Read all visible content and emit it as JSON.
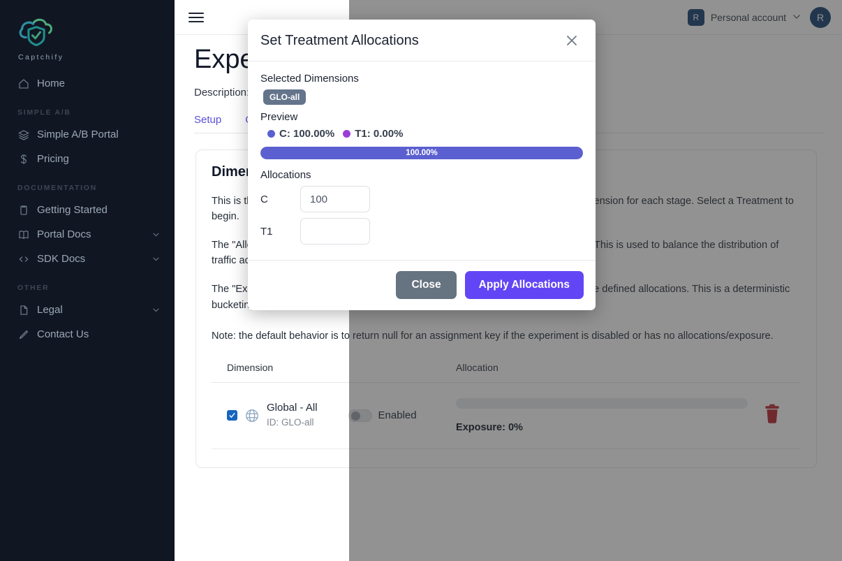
{
  "sidebar": {
    "brand_name": "Captchify",
    "items": [
      {
        "label": "Home",
        "icon": "home-icon",
        "section": null,
        "chevron": false
      },
      {
        "label": "Simple A/B Portal",
        "icon": "layers-icon",
        "section": null,
        "chevron": false
      },
      {
        "label": "Pricing",
        "icon": "dollar-icon",
        "section": null,
        "chevron": false
      },
      {
        "label": "Getting Started",
        "icon": "clipboard-icon",
        "section": null,
        "chevron": false
      },
      {
        "label": "Portal Docs",
        "icon": "book-icon",
        "section": null,
        "chevron": true
      },
      {
        "label": "SDK Docs",
        "icon": "code-icon",
        "section": null,
        "chevron": true
      },
      {
        "label": "Legal",
        "icon": "document-icon",
        "section": null,
        "chevron": true
      },
      {
        "label": "Contact Us",
        "icon": "pencil-icon",
        "section": null,
        "chevron": false
      }
    ],
    "sections": {
      "simple_ab": "SIMPLE A/B",
      "documentation": "DOCUMENTATION",
      "other": "OTHER"
    }
  },
  "topbar": {
    "menu_icon": "hamburger-icon",
    "account_initial": "R",
    "account_name": "Personal account",
    "chevron": "⌄",
    "avatar_initial": "R"
  },
  "page": {
    "title": "Experiments",
    "description": "Description: v",
    "tabs": [
      {
        "label": "Setup"
      },
      {
        "label": "Overview"
      }
    ],
    "card_title": "Dimensions",
    "paragraphs": [
      "This is the list of dimensions for this experiment. Configure the allocation of each dimension for each stage. Select a Treatment to begin.",
      "The \"Allocation\" bar shows the relative weight of each dimension for each treatment. This is used to balance the distribution of traffic across treatments.",
      "The \"Exposure\" is the percentage of traffic for this dimension that will be subject to the defined allocations. This is a deterministic bucketing based on the assignment key and the experiment settings."
    ],
    "note": "Note: the default behavior is to return null for an assignment key if the experiment is disabled or has no allocations/exposure.",
    "table": {
      "headers": [
        "Dimension",
        "Allocation",
        ""
      ],
      "rows": [
        {
          "checked": true,
          "icon": "globe-icon",
          "name": "Global - All",
          "id": "ID: GLO-all",
          "toggle_enabled": false,
          "toggle_label": "Enabled",
          "allocation_percent": 0,
          "exposure": "Exposure: 0%",
          "delete_icon": "trash-icon"
        }
      ]
    }
  },
  "modal": {
    "title": "Set Treatment Allocations",
    "close_icon": "close-icon",
    "selected_dimensions_label": "Selected Dimensions",
    "selected_dimensions": [
      "GLO-all"
    ],
    "preview_label": "Preview",
    "preview_items": [
      {
        "label": "C: 100.00%",
        "color": "#5b5fd0"
      },
      {
        "label": "T1: 0.00%",
        "color": "#9b3fd6"
      }
    ],
    "progress_label": "100.00%",
    "progress_value": 100,
    "allocations_label": "Allocations",
    "allocations": [
      {
        "key": "C",
        "value": "100",
        "placeholder": ""
      },
      {
        "key": "T1",
        "value": "",
        "placeholder": ""
      }
    ],
    "close_button": "Close",
    "apply_button": "Apply Allocations"
  },
  "colors": {
    "accent_purple": "#6246f5",
    "progress_purple": "#5b5fd0",
    "badge_slate": "#64748b",
    "close_gray": "#667380",
    "avatar_navy": "#154272",
    "trash_red": "#b9262c",
    "sidebar_bg": "#111722"
  }
}
